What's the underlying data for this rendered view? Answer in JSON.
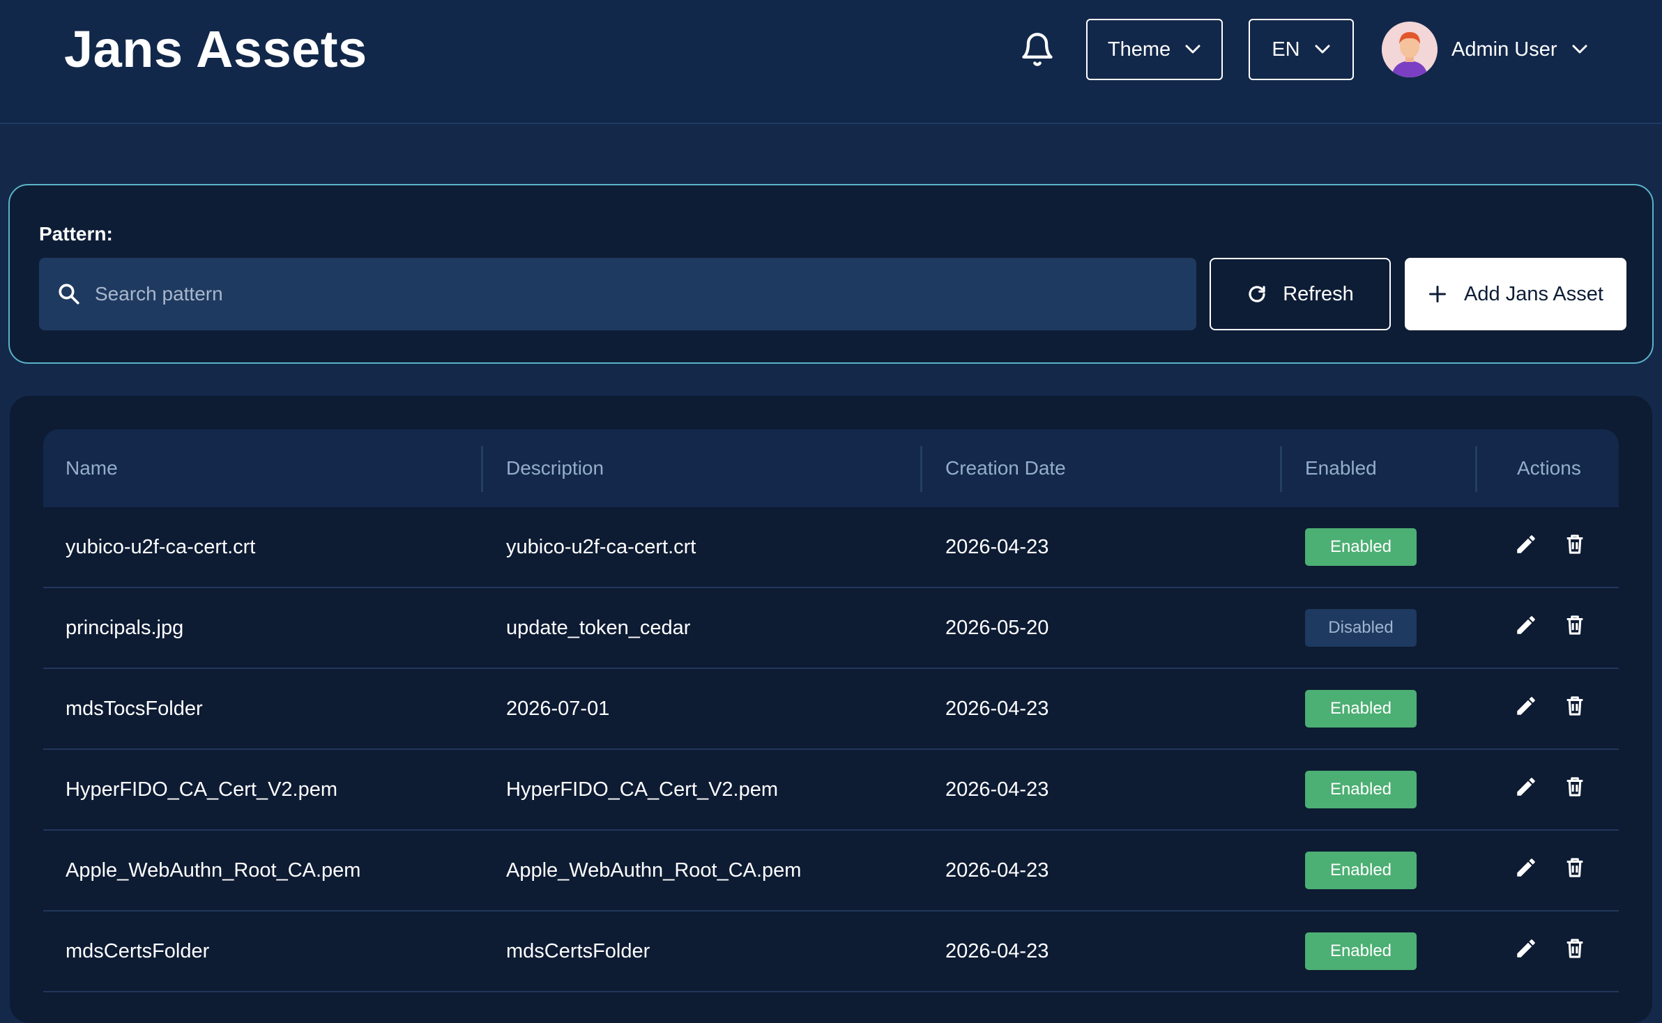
{
  "header": {
    "title": "Jans Assets",
    "theme_label": "Theme",
    "lang_label": "EN",
    "user_name": "Admin User"
  },
  "search": {
    "label": "Pattern:",
    "placeholder": "Search pattern",
    "value": "",
    "refresh_label": "Refresh",
    "add_label": "Add Jans Asset"
  },
  "table": {
    "columns": [
      "Name",
      "Description",
      "Creation Date",
      "Enabled",
      "Actions"
    ],
    "rows": [
      {
        "name": "yubico-u2f-ca-cert.crt",
        "description": "yubico-u2f-ca-cert.crt",
        "date": "2026-04-23",
        "status": "Enabled",
        "enabled": true
      },
      {
        "name": "principals.jpg",
        "description": "update_token_cedar",
        "date": "2026-05-20",
        "status": "Disabled",
        "enabled": false
      },
      {
        "name": "mdsTocsFolder",
        "description": "2026-07-01",
        "date": "2026-04-23",
        "status": "Enabled",
        "enabled": true
      },
      {
        "name": "HyperFIDO_CA_Cert_V2.pem",
        "description": "HyperFIDO_CA_Cert_V2.pem",
        "date": "2026-04-23",
        "status": "Enabled",
        "enabled": true
      },
      {
        "name": "Apple_WebAuthn_Root_CA.pem",
        "description": "Apple_WebAuthn_Root_CA.pem",
        "date": "2026-04-23",
        "status": "Enabled",
        "enabled": true
      },
      {
        "name": "mdsCertsFolder",
        "description": "mdsCertsFolder",
        "date": "2026-04-23",
        "status": "Enabled",
        "enabled": true
      }
    ]
  },
  "colors": {
    "background": "#14284a",
    "panel": "#0e1d36",
    "accent_border": "#5ab3c8",
    "enabled_badge": "#4caf73",
    "disabled_badge": "#1f3a60"
  },
  "icons": [
    "bell-icon",
    "chevron-down-icon",
    "avatar",
    "search-icon",
    "refresh-icon",
    "plus-icon",
    "edit-icon",
    "delete-icon"
  ]
}
